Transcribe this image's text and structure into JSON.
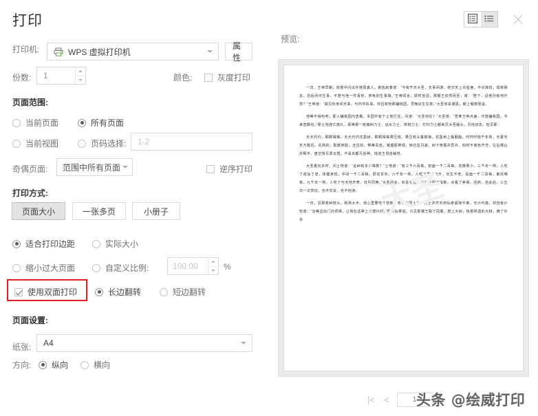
{
  "dialog": {
    "title": "打印"
  },
  "printer": {
    "label": "打印机:",
    "value": "WPS 虚拟打印机",
    "icon": "printer-icon",
    "properties_button": "属性"
  },
  "copies": {
    "label": "份数:",
    "value": "1"
  },
  "color": {
    "label": "颜色:",
    "grayscale_label": "灰度打印",
    "grayscale_checked": false
  },
  "page_range": {
    "heading": "页面范围:",
    "options": [
      {
        "label": "当前页面",
        "selected": false
      },
      {
        "label": "所有页面",
        "selected": true
      },
      {
        "label": "当前视图",
        "selected": false
      },
      {
        "label": "页码选择:",
        "selected": false
      }
    ],
    "pages_input_placeholder": "1-2",
    "odd_even_label": "奇偶页面:",
    "odd_even_value": "范围中所有页面",
    "reverse_label": "逆序打印",
    "reverse_checked": false
  },
  "print_mode": {
    "heading": "打印方式:",
    "buttons": [
      {
        "label": "页面大小",
        "selected": true
      },
      {
        "label": "一张多页",
        "selected": false
      },
      {
        "label": "小册子",
        "selected": false
      }
    ],
    "scale_options": [
      {
        "label": "适合打印边距",
        "selected": true
      },
      {
        "label": "实际大小",
        "selected": false
      },
      {
        "label": "缩小过大页面",
        "selected": false
      },
      {
        "label": "自定义比例:",
        "selected": false
      }
    ],
    "custom_scale_placeholder": "100.00",
    "percent_symbol": "%",
    "duplex_label": "使用双面打印",
    "duplex_checked": true,
    "duplex_flip": [
      {
        "label": "长边翻转",
        "selected": true
      },
      {
        "label": "短边翻转",
        "selected": false
      }
    ],
    "highlight_color": "#e02020"
  },
  "page_setup": {
    "heading": "页面设置:",
    "paper_label": "纸张:",
    "paper_value": "A4",
    "orientation_label": "方向:",
    "orientation_options": [
      {
        "label": "纵向",
        "selected": true
      },
      {
        "label": "横向",
        "selected": false
      }
    ]
  },
  "preview": {
    "label": "预览:",
    "view_single_icon": "list-boxed-icon",
    "view_multi_icon": "list-lines-icon",
    "close_icon": "close-icon",
    "page_watermark": "大圣",
    "document_paragraphs": [
      "一日，王帝早朝，班部中闪出许旌阳真人，俯囟启奏道：“今有齐天大圣，无事闲游，结交天上众星宿，不论高低，俱称朋友。恐后闲中生事，不若与他一件事管，庶免别生事端。”王帝闻言，即时宣诏，那猴王欣然而至，道：“陛下，诏老孙有何升赏？”王帝道：“朕见你身闲无事，与你件执事，你且权管那蟠桃园，早晚好生在意。”大圣欢喜谢恩，朝上唱喏而退。",
      "他等不得吩咐，即入蟠桃园内查勘。本园中有个土地拦住，问道：“大圣何往？”大圣道：“吾奉王帝点差，代管蟠桃园，今来查勘也。”那土地连忙施礼，即唤那一班锄树力士、运水力士、修桃力士、打扫力士都来见大圣磕头，引他进去。但见那：",
      "夭夭灼灼，颗颗株株。夭夭灼灼花盈树，颗颗株株果压枝。果压枝头垂锦弹，花盈树上簇胭脂。时开时结千年熟，无夏无冬万载迟。先熟的，酡颜醉脸；还生的，带蒂青皮。凝烟肌带绿，映日显丹姿。树下奇葩并异卉，四时不谢色齐齐。左右楼台并殿宇，盘空常见罩云霓。不是玄都凡俗种，瑶池王母自栽培。",
      "大圣看玩多时，问土地道：“此树有多少株数？”土地道：“有三千六百株。前面一千二百株，花微果小，三千年一熟，人吃了成仙了道，体健身轻。中间一千二百株，层花甘实，六千年一熟，人吃了霞举飞升，长生不老。后面一千二百株，紫纹缃核，九千年一熟，人吃了与天地齐寿，日月同庚。”大圣闻言，欢喜无任，当日查明了株数，点看了亭阁，回府。自此后，三五日一次赏玩，也不交友，也不他游。",
      "一日，见那老树枝头，桃熟大半，他心里要吃个尝新。奈何本园土地，力士并齐天府仙吏紧随不离，无计可施，却自有计较道：“汝等且出门外伺候，让我在这亭上少憩片时。”那众仙果退。只见那猴王脱了冠服，爬上大树，拣那熟透的大桃，摘了许多"
    ],
    "pager": {
      "first_icon": "first-page-icon",
      "prev_icon": "prev-page-icon",
      "current_page": "1",
      "separator": "/"
    }
  },
  "overlay_watermark": "头条 @绘威打印"
}
